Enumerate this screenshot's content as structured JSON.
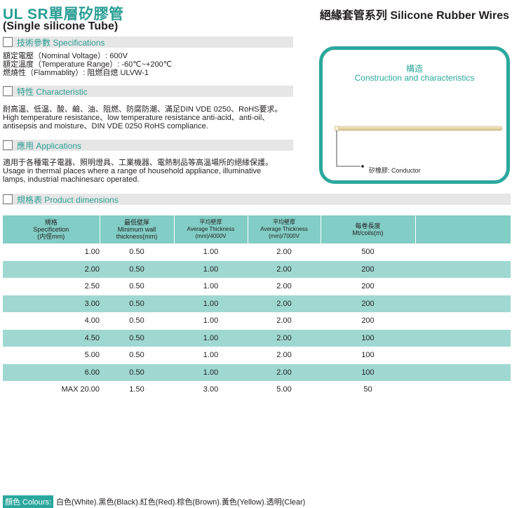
{
  "header": {
    "title": "UL SR單層矽膠管",
    "subtitle": "(Single silicone Tube)",
    "series": "絕緣套管系列 Silicone Rubber Wires"
  },
  "specs": {
    "heading": "技術參數 Specifications",
    "lines": [
      "額定電壓（Nominal Voltage）: 600V",
      "額定溫度（Temperature Range）: -60℃~+200℃",
      "燃燒性（Flammablity）: 阻燃自熄 ULVW-1"
    ]
  },
  "characteristic": {
    "heading": "特性 Characteristic",
    "lines": [
      "耐高温、低温、酸、鹼、油、阻燃、防腐防潮、滿足DIN VDE 0250、RoHS要求。",
      "High temperature resistance、low temperature resistance anti-acid、anti-oil、",
      "antisepsis and moisture、DIN VDE 0250 RoHS compliance."
    ]
  },
  "applications": {
    "heading": "應用 Applications",
    "lines": [
      "適用于各種電子電器、照明燈具、工業機器、電熱制品等高溫場所的絕緣保護。",
      "Usage in thermal places where a range of household appliance, illuminative",
      "lamps, industrial machinesarc operated."
    ]
  },
  "construction": {
    "title_cn": "構造",
    "title_en": "Construction and characteristics",
    "conductor_label": "矽橡膠: Conductor"
  },
  "dimensions": {
    "heading": "規格表 Product dimensions",
    "columns": [
      {
        "l1": "規格",
        "l2": "Specificetion",
        "l3": "(内徑mm)"
      },
      {
        "l1": "最低壁厚",
        "l2": "Minimum wall thickness(mm)",
        "l3": ""
      },
      {
        "l1": "平均壁厚",
        "l2": "Average Thickness",
        "l3": "(mm)/4000V"
      },
      {
        "l1": "平均壁厚",
        "l2": "Average Thickness",
        "l3": "(mm)/7000V"
      },
      {
        "l1": "每卷長度",
        "l2": "Mt/coils(m)",
        "l3": ""
      }
    ],
    "rows": [
      [
        "1.00",
        "0.50",
        "1.00",
        "2.00",
        "500"
      ],
      [
        "2.00",
        "0.50",
        "1.00",
        "2.00",
        "200"
      ],
      [
        "2.50",
        "0.50",
        "1.00",
        "2.00",
        "200"
      ],
      [
        "3.00",
        "0.50",
        "1.00",
        "2.00",
        "200"
      ],
      [
        "4.00",
        "0.50",
        "1.00",
        "2.00",
        "200"
      ],
      [
        "4.50",
        "0.50",
        "1.00",
        "2.00",
        "100"
      ],
      [
        "5.00",
        "0.50",
        "1.00",
        "2.00",
        "100"
      ],
      [
        "6.00",
        "0.50",
        "1.00",
        "2.00",
        "100"
      ],
      [
        "MAX 20.00",
        "1.50",
        "3.00",
        "5.00",
        "50"
      ]
    ]
  },
  "colors": {
    "label": "顏色 Colours:",
    "values": "白色(White).黑色(Black).紅色(Red).棕色(Brown).黃色(Yellow).透明(Clear)"
  },
  "palette": {
    "accent": "#2aa79d",
    "header_row": "#82cdc6",
    "alt_row": "#9fd8d1",
    "section_bar": "#e6e6e6"
  }
}
